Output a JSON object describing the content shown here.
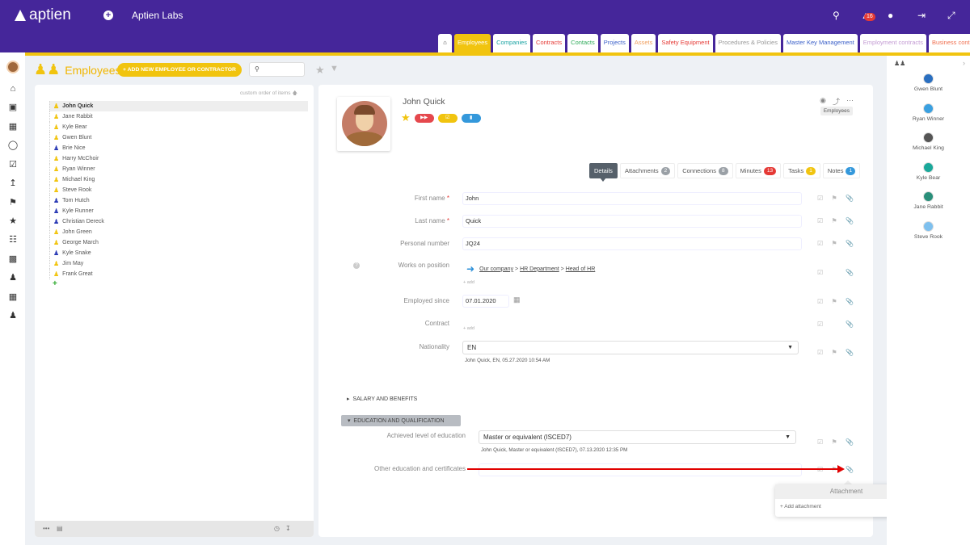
{
  "app": {
    "logo_text": "aptien",
    "org_name": "Aptien Labs",
    "notification_count": "16",
    "icons": [
      "search-icon",
      "bell-icon",
      "chat-icon",
      "logout-icon",
      "collapse-icon"
    ]
  },
  "tabs": [
    {
      "label": "Employees",
      "color": "#ffffff",
      "active": true
    },
    {
      "label": "Companies",
      "color": "#1aa3a3"
    },
    {
      "label": "Contracts",
      "color": "#e53935"
    },
    {
      "label": "Contacts",
      "color": "#2eaa5a"
    },
    {
      "label": "Projects",
      "color": "#3a5fc8"
    },
    {
      "label": "Assets",
      "color": "#f0a060"
    },
    {
      "label": "Safety Equipment",
      "color": "#e53935"
    },
    {
      "label": "Procedures & Policies",
      "color": "#999999"
    },
    {
      "label": "Master Key Management",
      "color": "#3a5fc8"
    },
    {
      "label": "Employment contracts",
      "color": "#c39bd3"
    },
    {
      "label": "Business contracts",
      "color": "#f07050"
    }
  ],
  "page": {
    "title": "Employees",
    "add_button": "+ ADD NEW EMPLOYEE OR CONTRACTOR",
    "search_value": "",
    "custom_order": "custom order of items"
  },
  "employees": [
    {
      "name": "John Quick",
      "type": "y",
      "selected": true
    },
    {
      "name": "Jane Rabbit",
      "type": "y"
    },
    {
      "name": "Kyle Bear",
      "type": "y"
    },
    {
      "name": "Gwen Blunt",
      "type": "y"
    },
    {
      "name": "Brie Nice",
      "type": "b"
    },
    {
      "name": "Harry McChoir",
      "type": "y"
    },
    {
      "name": "Ryan Winner",
      "type": "y"
    },
    {
      "name": "Michael King",
      "type": "y"
    },
    {
      "name": "Steve Rook",
      "type": "y"
    },
    {
      "name": "Tom Hutch",
      "type": "b"
    },
    {
      "name": "Kyle Runner",
      "type": "b"
    },
    {
      "name": "Christian Dereck",
      "type": "b"
    },
    {
      "name": "John Green",
      "type": "y"
    },
    {
      "name": "George March",
      "type": "y"
    },
    {
      "name": "Kyle Snake",
      "type": "b"
    },
    {
      "name": "Jim May",
      "type": "y"
    },
    {
      "name": "Frank Great",
      "type": "y"
    }
  ],
  "detail": {
    "name": "John Quick",
    "category_tag": "Employees",
    "tabs": [
      {
        "label": "Details",
        "count": null
      },
      {
        "label": "Attachments",
        "count": "2",
        "color": "#9aa0a6"
      },
      {
        "label": "Connections",
        "count": "8",
        "color": "#9aa0a6"
      },
      {
        "label": "Minutes",
        "count": "13",
        "color": "#e53935"
      },
      {
        "label": "Tasks",
        "count": "1",
        "color": "#f1c40f"
      },
      {
        "label": "Notes",
        "count": "1",
        "color": "#3498db"
      }
    ],
    "fields": {
      "first_name_label": "First name",
      "first_name": "John",
      "last_name_label": "Last name",
      "last_name": "Quick",
      "personal_number_label": "Personal number",
      "personal_number": "JQ24",
      "position_label": "Works on position",
      "position_path": [
        "Our company",
        "HR Department",
        "Head of HR"
      ],
      "add_label": "+ add",
      "employed_since_label": "Employed since",
      "employed_since": "07.01.2020",
      "contract_label": "Contract",
      "nationality_label": "Nationality",
      "nationality": "EN",
      "nationality_hint": "John Quick, EN, 05.27.2020 10:54 AM"
    },
    "sections": {
      "salary": "SALARY AND BENEFITS",
      "education": "EDUCATION AND QUALIFICATION"
    },
    "education": {
      "level_label": "Achieved level of education",
      "level_value": "Master or equivalent (ISCED7)",
      "level_hint": "John Quick, Master or equivalent (ISCED7), 07.13.2020 12:35 PM",
      "other_label": "Other education and certificates",
      "other_value": ""
    }
  },
  "popup": {
    "title": "Attachment",
    "add": "+ Add attachment"
  },
  "right_panel": {
    "people": [
      {
        "name": "Gwen Blunt",
        "color": "#2a6fc0"
      },
      {
        "name": "Ryan Winner",
        "color": "#3aa0e0"
      },
      {
        "name": "Michael King",
        "color": "#555555"
      },
      {
        "name": "Kyle Bear",
        "color": "#1aa89a"
      },
      {
        "name": "Jane Rabbit",
        "color": "#2a8f7a"
      },
      {
        "name": "Steve Rook",
        "color": "#7ec0ee"
      }
    ]
  }
}
